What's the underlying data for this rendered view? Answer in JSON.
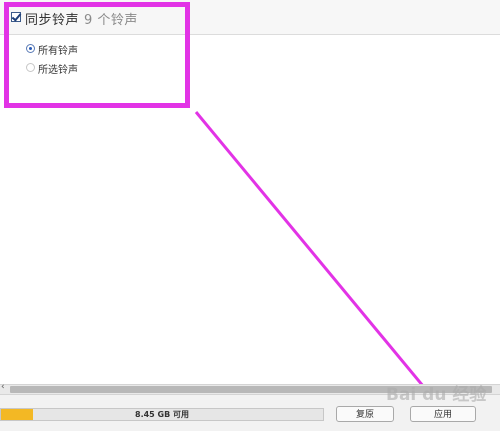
{
  "sync_section": {
    "checkbox_checked": true,
    "title": "同步铃声",
    "count": "9 个铃声",
    "options": [
      {
        "label": "所有铃声",
        "selected": true
      },
      {
        "label": "所选铃声",
        "selected": false
      }
    ]
  },
  "storage": {
    "available_label": "8.45 GB 可用",
    "used_fraction": 0.1,
    "used_color": "#f3b824"
  },
  "buttons": {
    "revert_label": "复原",
    "apply_label": "应用"
  },
  "annotation": {
    "color": "#e233e6"
  },
  "watermark": {
    "text": "Bai du 经验"
  }
}
